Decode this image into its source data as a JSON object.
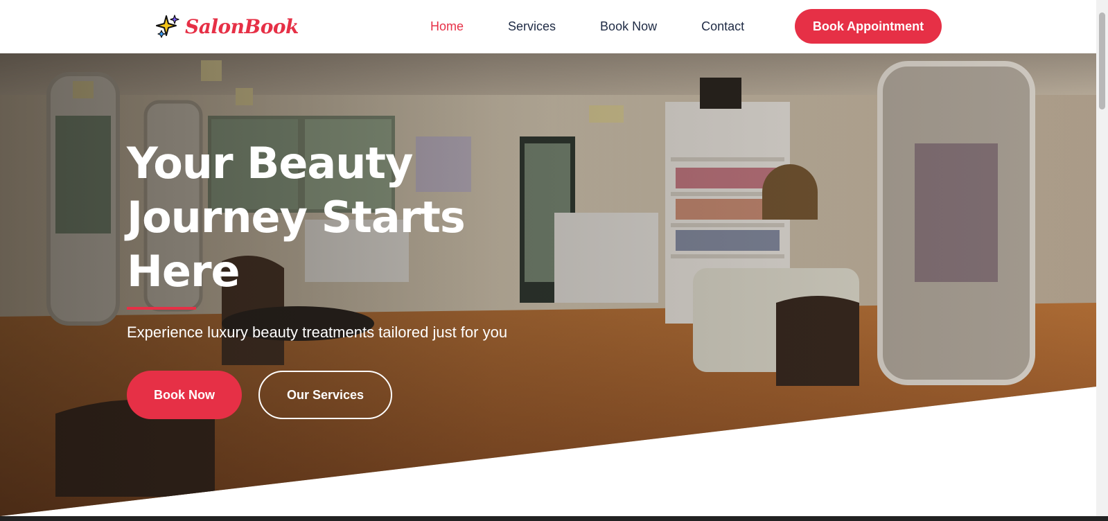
{
  "brand": {
    "name": "SalonBook",
    "icon": "sparkles-icon",
    "color": "#e63046"
  },
  "nav": {
    "links": [
      {
        "label": "Home",
        "active": true
      },
      {
        "label": "Services",
        "active": false
      },
      {
        "label": "Book Now",
        "active": false
      },
      {
        "label": "Contact",
        "active": false
      }
    ],
    "cta": "Book Appointment"
  },
  "hero": {
    "title": "Your Beauty Journey Starts Here",
    "subtitle": "Experience luxury beauty treatments tailored just for you",
    "primary_button": "Book Now",
    "secondary_button": "Our Services",
    "background": "salon-interior-photo"
  },
  "colors": {
    "accent": "#e63046",
    "text": "#1e2a44",
    "white": "#ffffff"
  }
}
